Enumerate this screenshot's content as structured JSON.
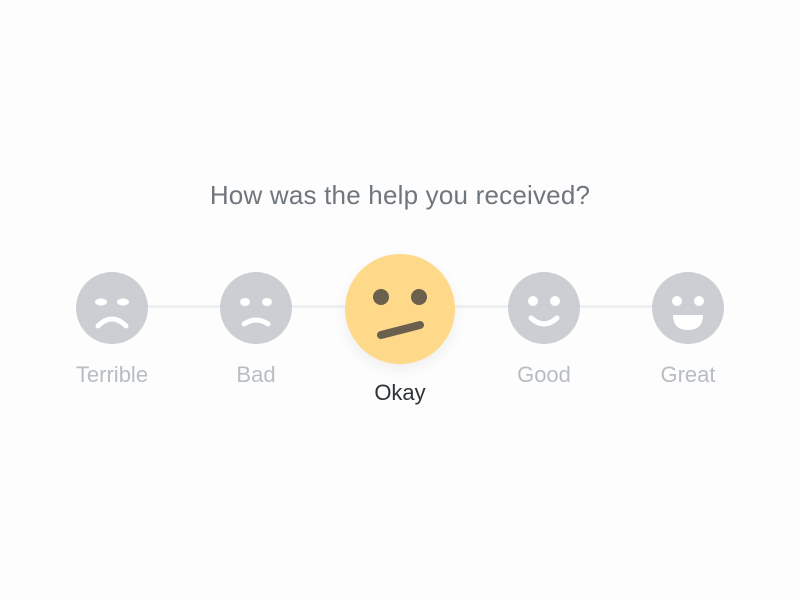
{
  "question": "How was the help you received?",
  "selected_value": "Okay",
  "colors": {
    "face_default": "#cbced3",
    "face_selected": "#ffd98a",
    "feature_default": "#ffffff",
    "feature_selected": "#6b5f4d",
    "label_default": "#b8bdc2",
    "label_selected": "#2e3338"
  },
  "options": [
    {
      "label": "Terrible",
      "icon": "terrible-face-icon"
    },
    {
      "label": "Bad",
      "icon": "bad-face-icon"
    },
    {
      "label": "Okay",
      "icon": "okay-face-icon"
    },
    {
      "label": "Good",
      "icon": "good-face-icon"
    },
    {
      "label": "Great",
      "icon": "great-face-icon"
    }
  ]
}
